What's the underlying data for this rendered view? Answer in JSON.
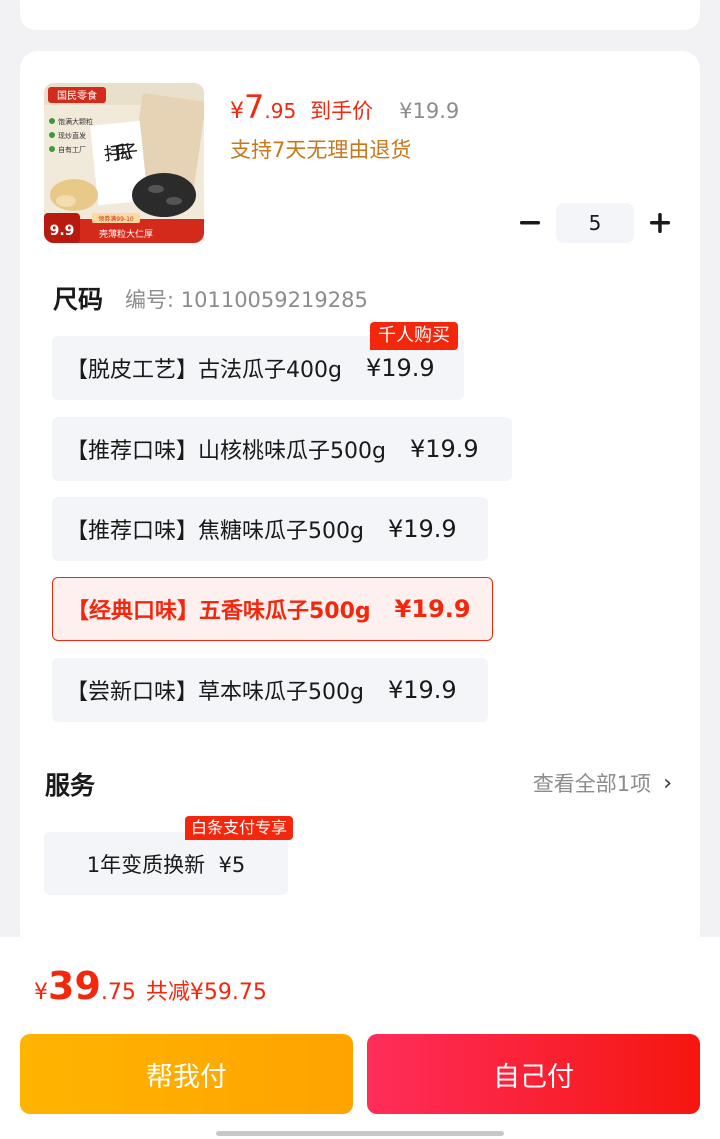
{
  "product": {
    "image_text": {
      "brand": "国民零食",
      "features": [
        "饱满大颗粒",
        "现炒直发",
        "自有工厂"
      ],
      "big": "打手瓜子",
      "price_tag": "9.9",
      "coupon": "领券满99-10",
      "slogan": "壳薄粒大仁厚"
    },
    "price_yen": "¥",
    "price_int": "7",
    "price_dec": ".95",
    "price_tag": "到手价",
    "original_price": "¥19.9",
    "return_policy": "支持7天无理由退货",
    "quantity": "5"
  },
  "size": {
    "title": "尺码",
    "code": "编号: 10110059219285",
    "options": [
      {
        "label": "【脱皮工艺】古法瓜子400g",
        "price": "¥19.9",
        "badge": "千人购买"
      },
      {
        "label": "【推荐口味】山核桃味瓜子500g",
        "price": "¥19.9"
      },
      {
        "label": "【推荐口味】焦糖味瓜子500g",
        "price": "¥19.9"
      },
      {
        "label": "【经典口味】五香味瓜子500g",
        "price": "¥19.9"
      },
      {
        "label": "【尝新口味】草本味瓜子500g",
        "price": "¥19.9"
      }
    ],
    "selected_index": 3
  },
  "service": {
    "title": "服务",
    "view_all": "查看全部1项",
    "item_label": "1年变质换新  ¥5",
    "item_badge": "白条支付专享"
  },
  "footer": {
    "total_yen": "¥",
    "total_int": "39",
    "total_dec": ".75",
    "savings": "共减¥59.75",
    "help_pay": "帮我付",
    "self_pay": "自己付"
  },
  "colors": {
    "accent": "#f2270c",
    "orange_button": "#ffb400",
    "red_button": "#ff2d5b",
    "policy_text": "#c8781a"
  }
}
